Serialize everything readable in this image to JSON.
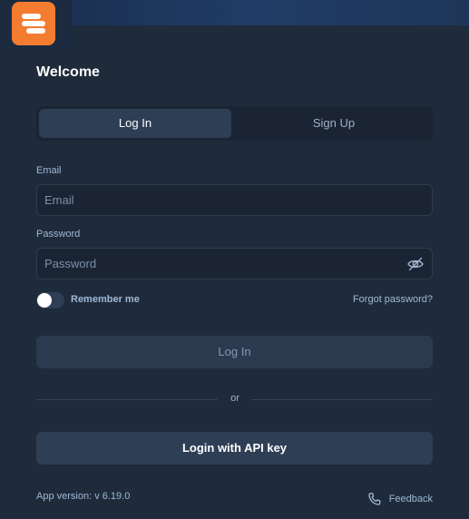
{
  "app": {
    "logo_icon": "app-logo-icon",
    "accent_color": "#f47c30"
  },
  "header": {
    "title": "Welcome"
  },
  "tabs": [
    {
      "label": "Log In",
      "active": true
    },
    {
      "label": "Sign Up",
      "active": false
    }
  ],
  "form": {
    "email_label": "Email",
    "email_placeholder": "Email",
    "email_value": "",
    "password_label": "Password",
    "password_placeholder": "Password",
    "password_value": "",
    "password_toggle_icon": "eye-off-icon",
    "remember_label": "Remember me",
    "remember_checked": false,
    "forgot_label": "Forgot password?",
    "login_button": "Log In",
    "or_label": "or",
    "api_key_button": "Login with API key"
  },
  "footer": {
    "version": "App version: v 6.19.0",
    "feedback_label": "Feedback",
    "feedback_icon": "phone-icon"
  }
}
